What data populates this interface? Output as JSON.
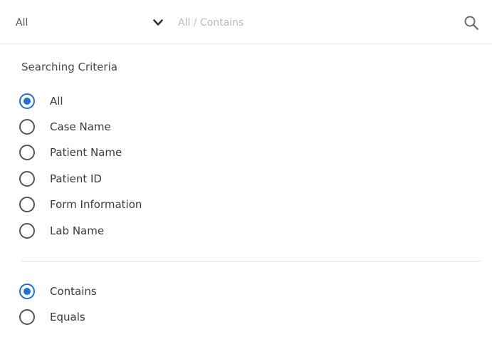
{
  "search": {
    "scope_value": "All",
    "placeholder": "All / Contains",
    "value": ""
  },
  "criteria": {
    "title": "Searching Criteria",
    "options": [
      {
        "label": "All",
        "checked": true
      },
      {
        "label": "Case Name",
        "checked": false
      },
      {
        "label": "Patient Name",
        "checked": false
      },
      {
        "label": "Patient ID",
        "checked": false
      },
      {
        "label": "Form Information",
        "checked": false
      },
      {
        "label": "Lab Name",
        "checked": false
      }
    ]
  },
  "match": {
    "options": [
      {
        "label": "Contains",
        "checked": true
      },
      {
        "label": "Equals",
        "checked": false
      }
    ]
  },
  "colors": {
    "accent": "#1e6fdb",
    "placeholder": "#b7bcc2",
    "divider": "#e3e3e3"
  }
}
